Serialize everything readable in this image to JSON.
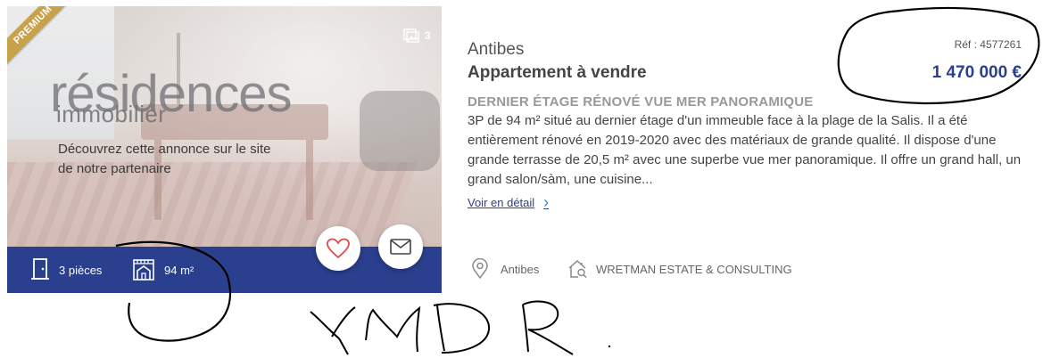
{
  "listing": {
    "badge": "PREMIUM",
    "photo_count": "3",
    "partner": {
      "logo_line1": "résidences",
      "logo_line2": "immobilier",
      "message": "Découvrez cette annonce sur le site de notre partenaire"
    },
    "features": {
      "rooms": "3 pièces",
      "area": "94 m²"
    },
    "city": "Antibes",
    "property_type": "Appartement à vendre",
    "reference": "Réf : 4577261",
    "price": "1 470 000 €",
    "headline": "DERNIER ÉTAGE RÉNOVÉ VUE MER PANORAMIQUE",
    "description": "3P de 94 m² situé au dernier étage d'un immeuble face à la plage de la Salis. Il a été entièrement rénové en 2019-2020 avec des matériaux de grande qualité. Il dispose d'une grande terrasse de 20,5 m² avec une superbe vue mer panoramique. Il offre un grand hall, un grand salon/sàm, une cuisine...",
    "detail_link": "Voir en détail",
    "location": "Antibes",
    "agency": "WRETMAN ESTATE & CONSULTING"
  },
  "annotation": {
    "handwriting": "YMDR"
  },
  "colors": {
    "brand_blue": "#2a3f8e",
    "premium_gold": "#c8a24a",
    "link_blue": "#3b82d6"
  },
  "icons": [
    "photos-icon",
    "door-icon",
    "floorplan-house-icon",
    "heart-icon",
    "envelope-icon",
    "chevron-right-icon",
    "map-pin-icon",
    "agency-house-icon"
  ]
}
